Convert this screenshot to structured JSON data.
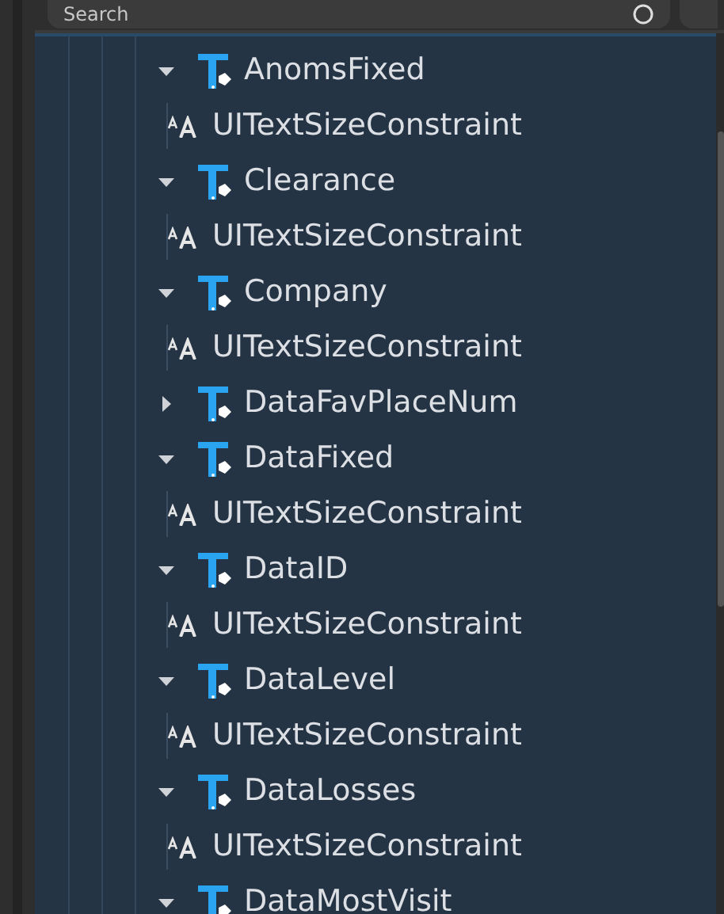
{
  "search": {
    "placeholder": "Search"
  },
  "tree": {
    "items": [
      {
        "label": "AnomsFixed",
        "expanded": true,
        "children": [
          {
            "label": "UITextSizeConstraint"
          }
        ]
      },
      {
        "label": "Clearance",
        "expanded": true,
        "children": [
          {
            "label": "UITextSizeConstraint"
          }
        ]
      },
      {
        "label": "Company",
        "expanded": true,
        "children": [
          {
            "label": "UITextSizeConstraint"
          }
        ]
      },
      {
        "label": "DataFavPlaceNum",
        "expanded": false
      },
      {
        "label": "DataFixed",
        "expanded": true,
        "children": [
          {
            "label": "UITextSizeConstraint"
          }
        ]
      },
      {
        "label": "DataID",
        "expanded": true,
        "children": [
          {
            "label": "UITextSizeConstraint"
          }
        ]
      },
      {
        "label": "DataLevel",
        "expanded": true,
        "children": [
          {
            "label": "UITextSizeConstraint"
          }
        ]
      },
      {
        "label": "DataLosses",
        "expanded": true,
        "children": [
          {
            "label": "UITextSizeConstraint"
          }
        ]
      },
      {
        "label": "DataMostVisit",
        "expanded": true
      }
    ]
  }
}
